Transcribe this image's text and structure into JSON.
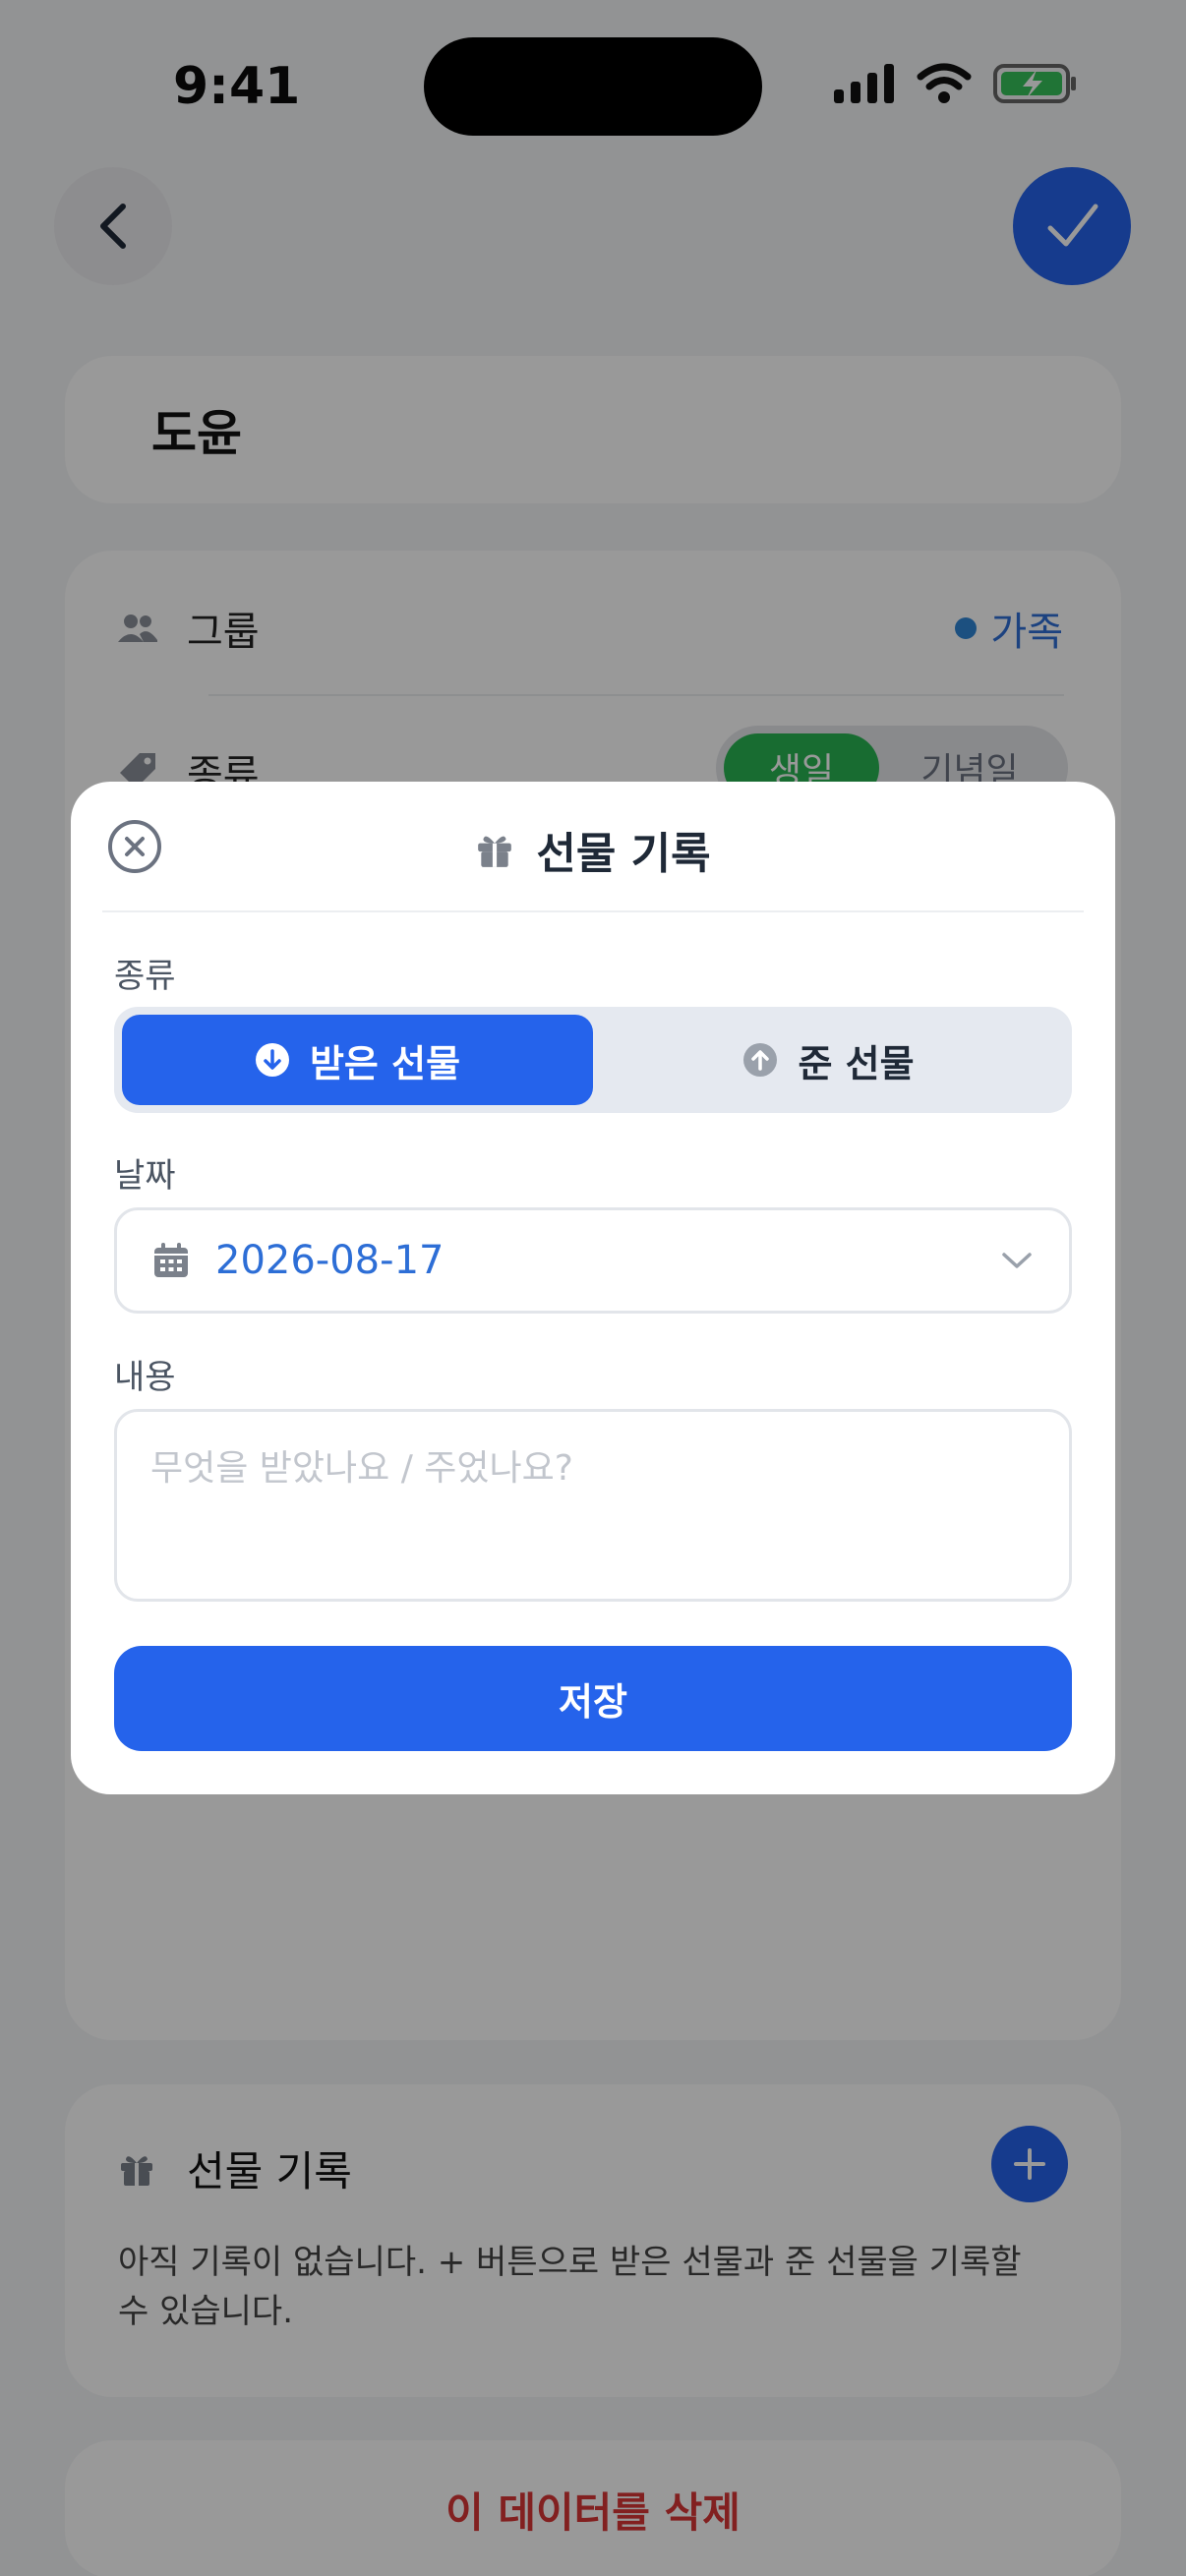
{
  "status_bar": {
    "time": "9:41"
  },
  "header": {
    "back_icon": "chevron-left-icon",
    "confirm_icon": "check-icon"
  },
  "profile": {
    "name": "도윤"
  },
  "info": {
    "group_label": "그룹",
    "group_value": "가족",
    "kind_label": "종류",
    "kind_options": [
      "생일",
      "기념일"
    ],
    "kind_selected": "생일"
  },
  "gifts": {
    "title": "선물 기록",
    "empty_text": "아직 기록이 없습니다. + 버튼으로 받은 선물과 준 선물을 기록할 수 있습니다."
  },
  "delete_label": "이 데이터를 삭제",
  "modal": {
    "title": "선물 기록",
    "kind_label": "종류",
    "received_label": "받은 선물",
    "given_label": "준 선물",
    "selected": "받은 선물",
    "date_label": "날짜",
    "date_value": "2026-08-17",
    "memo_label": "내용",
    "memo_placeholder": "무엇을 받았나요 / 주었나요?",
    "save_label": "저장"
  },
  "colors": {
    "accent": "#2563eb",
    "birthday_green": "#28b552",
    "delete_red": "#d93636",
    "group_dot": "#2f86d6"
  }
}
